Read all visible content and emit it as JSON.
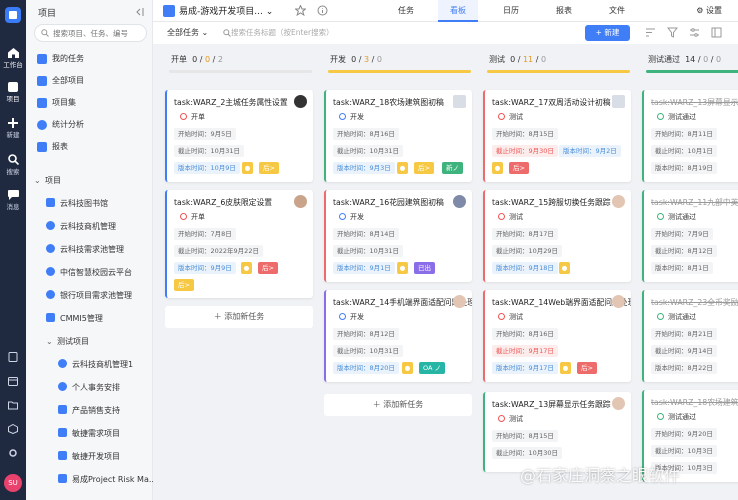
{
  "rail": {
    "items": [
      {
        "label": "工作台"
      },
      {
        "label": "项目"
      },
      {
        "label": "新建"
      },
      {
        "label": "搜索"
      },
      {
        "label": "消息"
      }
    ],
    "avatar": "SU"
  },
  "sidebar": {
    "title": "项目",
    "search_placeholder": "搜索项目、任务、编号",
    "items": [
      {
        "label": "我的任务"
      },
      {
        "label": "全部项目"
      },
      {
        "label": "项目集"
      },
      {
        "label": "统计分析"
      },
      {
        "label": "报表"
      }
    ],
    "tree_root": "项目",
    "tree": [
      {
        "label": "云科技图书馆"
      },
      {
        "label": "云科技商机管理"
      },
      {
        "label": "云科技需求池管理"
      },
      {
        "label": "中信智慧校园云平台"
      },
      {
        "label": "银行项目需求池管理"
      },
      {
        "label": "CMMI5管理"
      },
      {
        "label": "测试项目"
      },
      {
        "label": "云科技商机管理1"
      },
      {
        "label": "个人事务安排"
      },
      {
        "label": "产品销售支持"
      },
      {
        "label": "敏捷需求项目"
      },
      {
        "label": "敏捷开发项目"
      },
      {
        "label": "易成Project Risk Ma..."
      }
    ]
  },
  "header": {
    "project_title": "易成-游戏开发项目...",
    "tabs": [
      {
        "label": "任务"
      },
      {
        "label": "看板"
      },
      {
        "label": "日历"
      },
      {
        "label": "报表"
      },
      {
        "label": "文件"
      }
    ],
    "settings_label": "设置"
  },
  "toolbar": {
    "filter_label": "全部任务",
    "search_placeholder": "搜索任务标题（按Enter搜索）",
    "new_label": "+ 新建"
  },
  "board": {
    "add_task_label": "添加新任务",
    "columns": [
      {
        "name": "开单",
        "count_a": "0",
        "count_b": "0",
        "count_c": "2",
        "bar_color": "#e6e6e6",
        "cards": [
          {
            "title": "task:WARZ_2主城任务属性设置",
            "status": "开单",
            "start": "开始时间：9月5日",
            "end": "截止时间：10月31日",
            "version": "版本时间：10月9日",
            "tag1": "",
            "tag2": "后>"
          },
          {
            "title": "task:WARZ_6皮肤限定设置",
            "status": "开单",
            "start": "开始时间：7月8日",
            "end": "截止时间：2022年9月22日",
            "version": "版本时间：9月9日",
            "tag1": "",
            "tag2": "后>",
            "tag3": "后>"
          }
        ]
      },
      {
        "name": "开发",
        "count_a": "0",
        "count_b": "3",
        "count_c": "0",
        "bar_color": "#f6c844",
        "cards": [
          {
            "title": "task:WARZ_18农场建筑图初稿",
            "status": "开发",
            "start": "开始时间：8月16日",
            "end": "截止时间：10月31日",
            "version": "版本时间：9月3日",
            "tag2": "后>",
            "tag3": "新ノ"
          },
          {
            "title": "task:WARZ_16花园建筑图初稿",
            "status": "开发",
            "start": "开始时间：8月14日",
            "end": "截止时间：10月31日",
            "version": "版本时间：9月1日",
            "tag2": "已出"
          },
          {
            "title": "task:WARZ_14手机端界面适配问题处理",
            "status": "开发",
            "start": "开始时间：8月12日",
            "end": "截止时间：10月31日",
            "version": "版本时间：8月20日",
            "tag2": "OA ノ"
          }
        ]
      },
      {
        "name": "测试",
        "count_a": "0",
        "count_b": "11",
        "count_c": "0",
        "bar_color": "#f6c844",
        "cards": [
          {
            "title": "task:WARZ_17双周活动设计初稿",
            "status": "测试",
            "start": "开始时间：8月15日",
            "end": "截止时间：9月30日",
            "version": "版本时间：9月2日",
            "tag2": "后>"
          },
          {
            "title": "task:WARZ_15跨服切换任务跟踪",
            "status": "测试",
            "start": "开始时间：8月17日",
            "end": "截止时间：10月29日",
            "version": "版本时间：9月18日"
          },
          {
            "title": "task:WARZ_14Web端界面适配问题处理",
            "status": "测试",
            "start": "开始时间：8月16日",
            "end": "截止时间：9月17日",
            "version": "版本时间：9月17日",
            "tag2": "后>"
          },
          {
            "title": "task:WARZ_13屏幕显示任务跟踪",
            "status": "测试",
            "start": "开始时间：8月15日",
            "end": "截止时间：10月30日"
          }
        ]
      },
      {
        "name": "测试通过",
        "count_a": "14",
        "count_b": "0",
        "count_c": "0",
        "bar_color": "#3fb37d",
        "cards": [
          {
            "title": "task:WARZ_13屏幕显示任务跟踪",
            "status": "测试通过",
            "start": "开始时间：8月11日",
            "end": "截止时间：10月1日",
            "version": "版本时间：8月19日"
          },
          {
            "title": "task:WARZ_11九部中英文翻译",
            "status": "测试通过",
            "start": "开始时间：7月9日",
            "end": "截止时间：8月12日",
            "version": "版本时间：8月1日"
          },
          {
            "title": "task:WARZ_23全币奖励更新",
            "status": "测试通过",
            "start": "开始时间：8月21日",
            "end": "截止时间：9月14日",
            "version": "版本时间：8月22日"
          },
          {
            "title": "task:WARZ_18农场建筑图初稿",
            "status": "测试通过",
            "start": "开始时间：9月20日",
            "end": "截止时间：10月3日",
            "version": "版本时间：10月3日"
          }
        ]
      }
    ]
  },
  "watermark": "@石家庄洞察之眼软件"
}
